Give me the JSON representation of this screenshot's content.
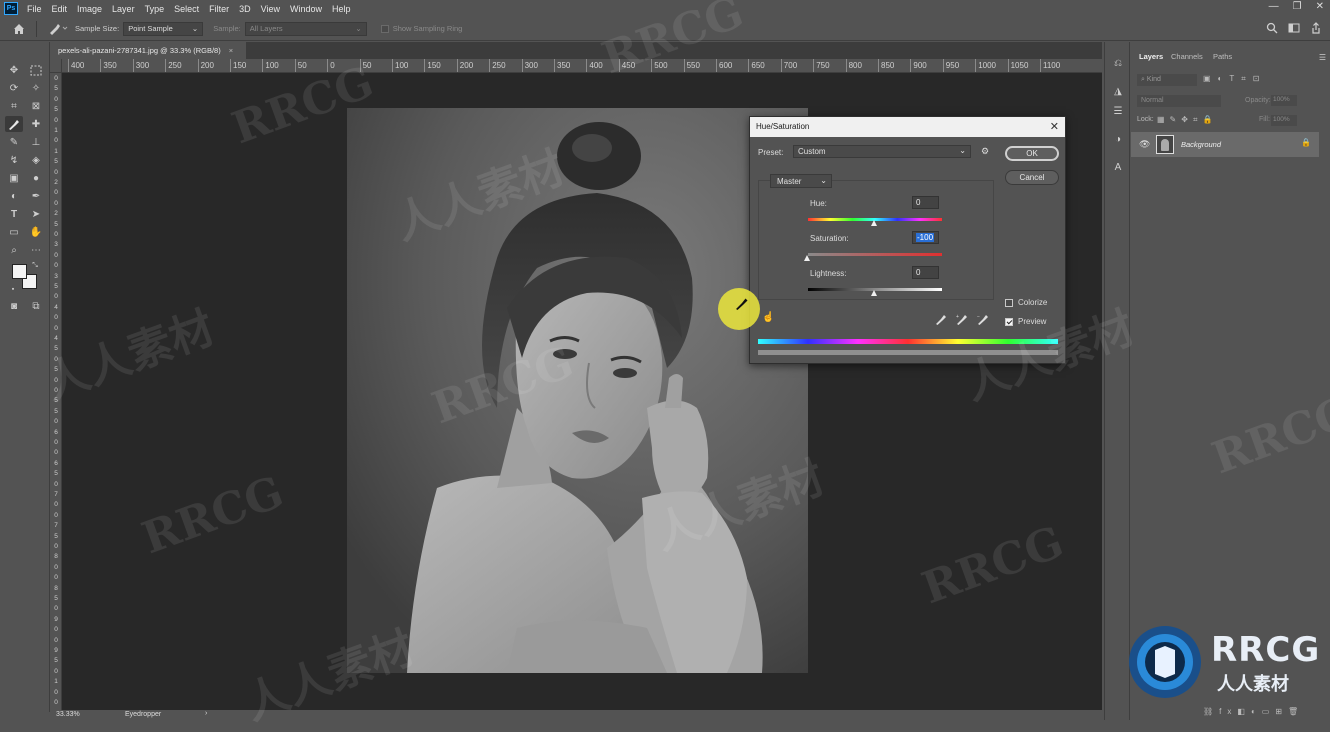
{
  "app": {
    "logo": "Ps"
  },
  "menubar": {
    "items": [
      "File",
      "Edit",
      "Image",
      "Layer",
      "Type",
      "Select",
      "Filter",
      "3D",
      "View",
      "Window",
      "Help"
    ]
  },
  "options_bar": {
    "sample_size_label": "Sample Size:",
    "sample_size_value": "Point Sample",
    "sample_label": "Sample:",
    "sample_value": "All Layers",
    "show_ring_label": "Show Sampling Ring"
  },
  "document": {
    "tab_title": "pexels-ali-pazani-2787341.jpg @ 33.3% (RGB/8)",
    "tab_close": "×"
  },
  "ruler_top": [
    "400",
    "350",
    "300",
    "250",
    "200",
    "150",
    "100",
    "50",
    "0",
    "50",
    "100",
    "150",
    "200",
    "250",
    "300",
    "350",
    "400",
    "450",
    "500",
    "550",
    "600",
    "650",
    "700",
    "750",
    "800",
    "850",
    "900",
    "950",
    "1000",
    "1050",
    "1100"
  ],
  "ruler_left": [
    "0",
    "5",
    "0",
    "5",
    "0",
    "1",
    "0",
    "1",
    "5",
    "0",
    "2",
    "0",
    "0",
    "2",
    "5",
    "0",
    "3",
    "0",
    "0",
    "3",
    "5",
    "0",
    "4",
    "0",
    "0",
    "4",
    "5",
    "0",
    "5",
    "0",
    "0",
    "5",
    "5",
    "0",
    "6",
    "0",
    "0",
    "6",
    "5",
    "0",
    "7",
    "0",
    "0",
    "7",
    "5",
    "0",
    "8",
    "0",
    "0",
    "8",
    "5",
    "0",
    "9",
    "0",
    "0",
    "9",
    "5",
    "0",
    "1",
    "0",
    "0"
  ],
  "statusbar": {
    "zoom": "33.33%",
    "tool": "Eyedropper",
    "arrow": "›"
  },
  "layers_panel": {
    "tabs": [
      "Layers",
      "Channels",
      "Paths"
    ],
    "kind_label": "Kind",
    "blend_mode": "Normal",
    "opacity_label": "Opacity:",
    "opacity_value": "100%",
    "lock_label": "Lock:",
    "fill_label": "Fill:",
    "fill_value": "100%",
    "layer_name": "Background"
  },
  "dialog": {
    "title": "Hue/Saturation",
    "close": "✕",
    "preset_label": "Preset:",
    "preset_value": "Custom",
    "ok_label": "OK",
    "cancel_label": "Cancel",
    "channel_value": "Master",
    "hue_label": "Hue:",
    "hue_value": "0",
    "saturation_label": "Saturation:",
    "saturation_value": "-100",
    "lightness_label": "Lightness:",
    "lightness_value": "0",
    "colorize_label": "Colorize",
    "colorize_checked": false,
    "preview_label": "Preview",
    "preview_checked": true,
    "hue_slider": 0.5,
    "saturation_slider": 0.0,
    "lightness_slider": 0.5
  },
  "watermarks": [
    "RRCG",
    "人人素材"
  ],
  "brand_logo": {
    "main": "RRCG",
    "sub": "人人素材"
  },
  "colors": {
    "accent": "#31a8ff",
    "selection": "#2a6fd6",
    "panel": "#535353",
    "canvas": "#282828"
  }
}
